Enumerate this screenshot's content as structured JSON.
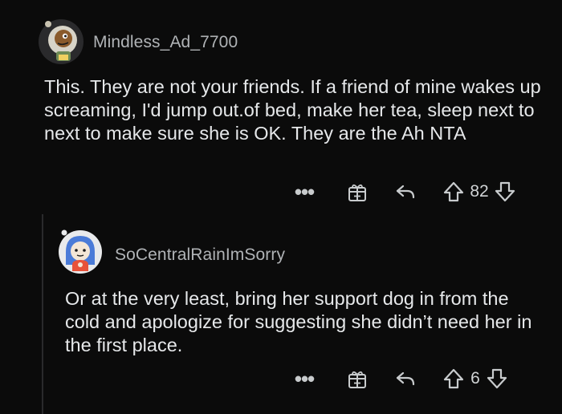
{
  "comments": [
    {
      "username": "Mindless_Ad_7700",
      "body": "This. They are not your friends. If a friend of mine wakes up screaming, I'd jump out.of bed, make her tea, sleep next to next to make sure she is OK. They are the Ah NTA",
      "votes": "82",
      "more_label": "•••"
    },
    {
      "username": "SoCentralRainImSorry",
      "body": "Or at the very least, bring her support dog in from the cold and apologize for suggesting she didn’t need her in the first place.",
      "votes": "6",
      "more_label": "•••"
    }
  ],
  "colors": {
    "background": "#0b0b0b",
    "text": "#e6e8ea",
    "muted": "#b0b3b6",
    "icon": "#c8cbcd",
    "avatar1_bg": "#d7d3c7",
    "avatar2_bg": "#4b7bd8"
  },
  "icons": {
    "more": "ellipsis-icon",
    "award": "gift-icon",
    "reply": "reply-arrow-icon",
    "upvote": "arrow-up-icon",
    "downvote": "arrow-down-icon"
  }
}
